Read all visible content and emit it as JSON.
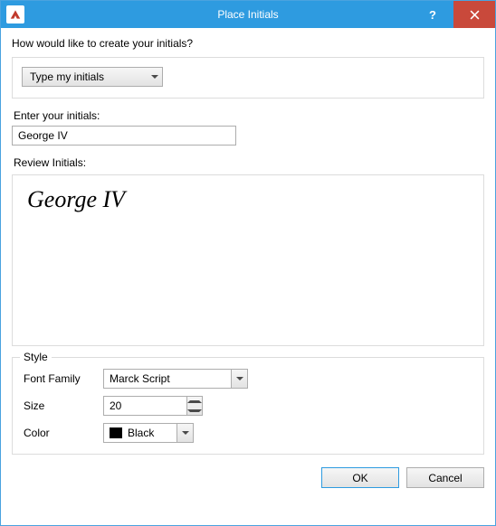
{
  "window": {
    "title": "Place Initials"
  },
  "question": "How would like to create your initials?",
  "method_dropdown": {
    "selected": "Type my initials"
  },
  "enter_label": "Enter your initials:",
  "initials_input_value": "George IV",
  "review_label": "Review Initials:",
  "preview_text": "George IV",
  "style": {
    "legend": "Style",
    "font_label": "Font Family",
    "font_value": "Marck Script",
    "size_label": "Size",
    "size_value": "20",
    "color_label": "Color",
    "color_name": "Black",
    "color_hex": "#000000"
  },
  "buttons": {
    "ok": "OK",
    "cancel": "Cancel"
  }
}
